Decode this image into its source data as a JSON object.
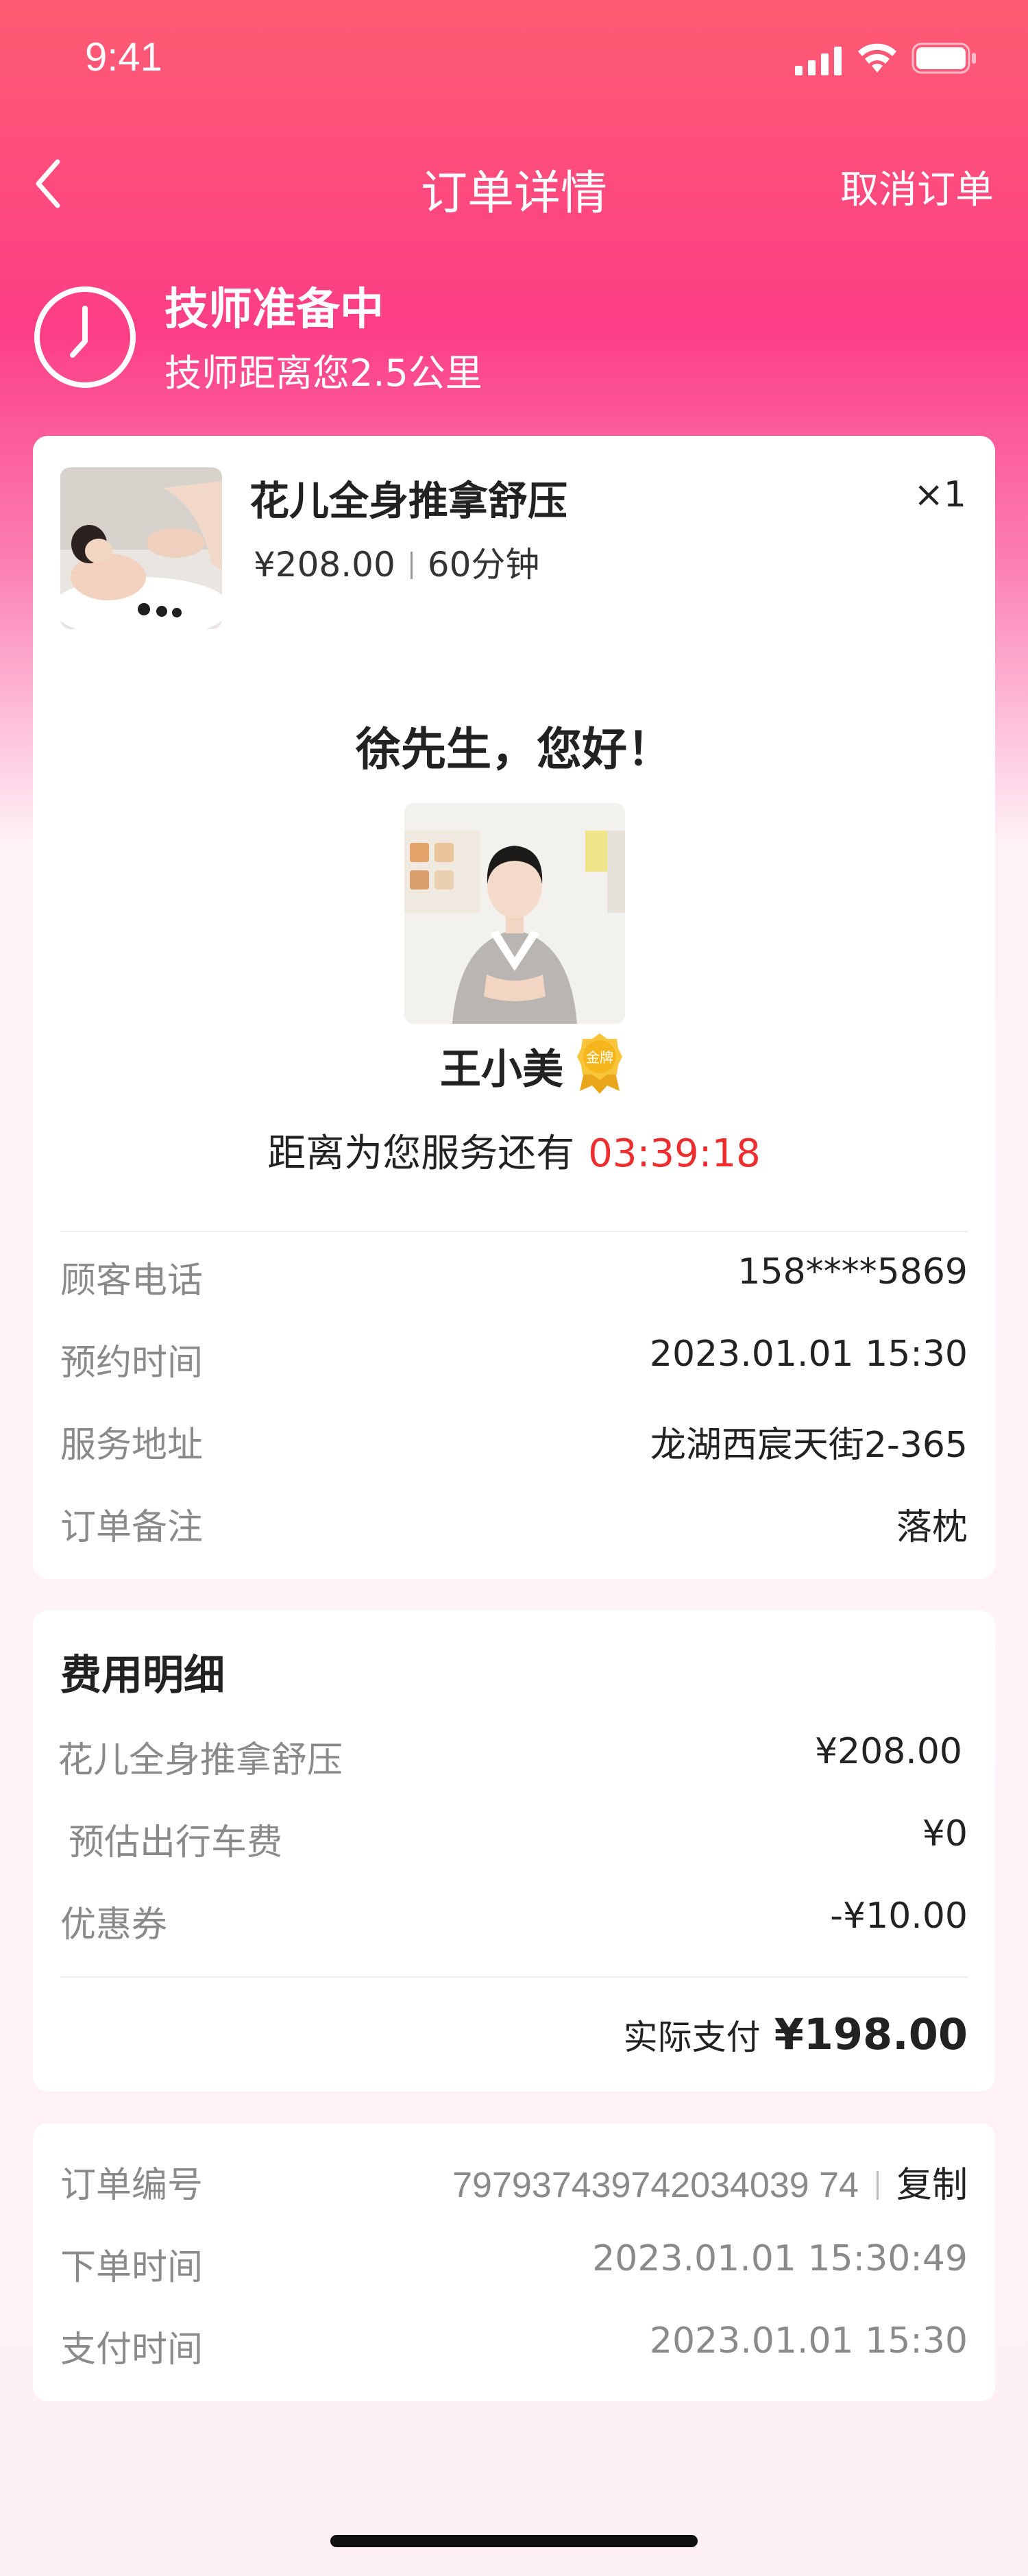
{
  "status_bar": {
    "time": "9:41"
  },
  "nav": {
    "title": "订单详情",
    "cancel_label": "取消订单"
  },
  "status": {
    "title": "技师准备中",
    "subtitle": "技师距离您2.5公里"
  },
  "product": {
    "name": "花儿全身推拿舒压",
    "price": "¥208.00",
    "duration": "60分钟",
    "quantity": "×1"
  },
  "technician": {
    "greeting": "徐先生，您好！",
    "name": "王小美",
    "badge": "金牌",
    "countdown_label": "距离为您服务还有",
    "countdown_value": "03:39:18"
  },
  "info": [
    {
      "label": "顾客电话",
      "value": "158****5869"
    },
    {
      "label": "预约时间",
      "value": "2023.01.01 15:30"
    },
    {
      "label": "服务地址",
      "value": "龙湖西宸天街2-365"
    },
    {
      "label": "订单备注",
      "value": "落枕"
    }
  ],
  "fees": {
    "title": "费用明细",
    "items": [
      {
        "label": "花儿全身推拿舒压",
        "value": "¥208.00"
      },
      {
        "label": "预估出行车费",
        "value": "¥0"
      },
      {
        "label": "优惠券",
        "value": "-¥10.00"
      }
    ],
    "total_label": "实际支付",
    "total_value": "¥198.00"
  },
  "order": {
    "number_label": "订单编号",
    "number_value": "797937439742034039 74",
    "copy_label": "复制",
    "created_label": "下单时间",
    "created_value": "2023.01.01 15:30:49",
    "paid_label": "支付时间",
    "paid_value": "2023.01.01 15:30"
  },
  "colors": {
    "accent_pink": "#fd3e86",
    "countdown_red": "#ee2e2e",
    "gold": "#f5b51b"
  }
}
